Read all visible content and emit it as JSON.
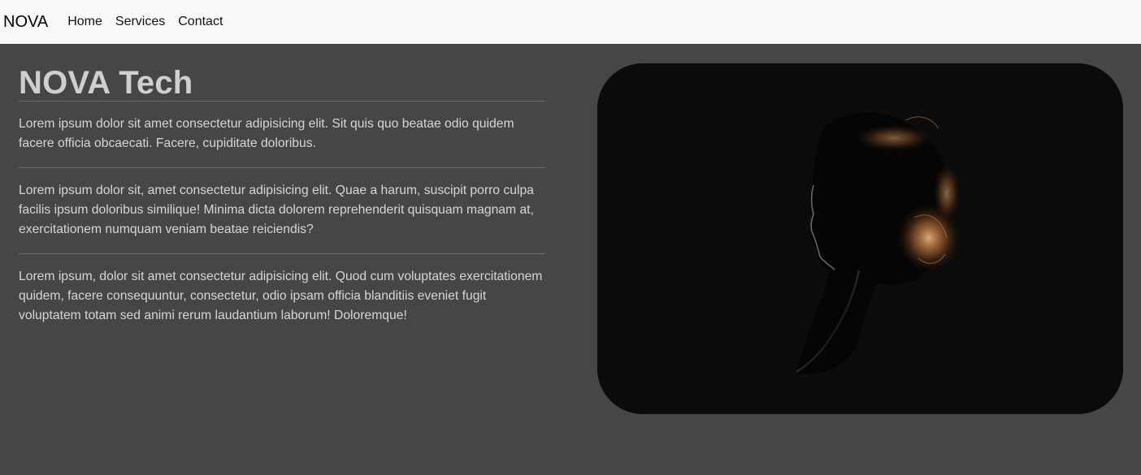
{
  "navbar": {
    "brand": "NOVA",
    "links": [
      {
        "label": "Home"
      },
      {
        "label": "Services"
      },
      {
        "label": "Contact"
      }
    ]
  },
  "main": {
    "title": "NOVA Tech",
    "paragraphs": [
      "Lorem ipsum dolor sit amet consectetur adipisicing elit. Sit quis quo beatae odio quidem facere officia obcaecati. Facere, cupiditate doloribus.",
      "Lorem ipsum dolor sit, amet consectetur adipisicing elit. Quae a harum, suscipit porro culpa facilis ipsum doloribus similique! Minima dicta dolorem reprehenderit quisquam magnam at, exercitationem numquam veniam beatae reiciendis?",
      "Lorem ipsum, dolor sit amet consectetur adipisicing elit. Quod cum voluptates exercitationem quidem, facere consequuntur, consectetur, odio ipsam officia blanditiis eveniet fugit voluptatem totam sed animi rerum laudantium laborum! Doloremque!"
    ]
  },
  "colors": {
    "navbar_bg": "#f8f9fa",
    "page_bg": "#464646",
    "text": "#d6d6d6",
    "title": "#cfcfcf",
    "image_bg": "#0b0b0b"
  }
}
